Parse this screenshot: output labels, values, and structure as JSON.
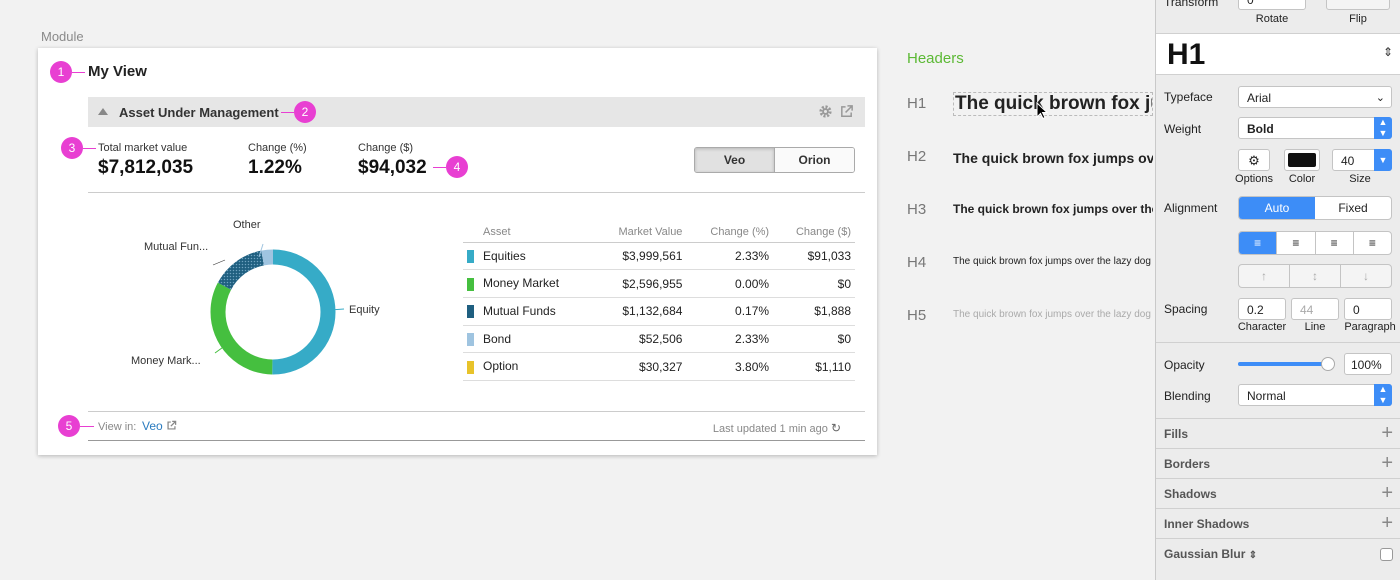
{
  "module_label": "Module",
  "card": {
    "title": "My View",
    "aum_title": "Asset Under Management",
    "stats": [
      {
        "label": "Total market value",
        "value": "$7,812,035"
      },
      {
        "label": "Change (%)",
        "value": "1.22%"
      },
      {
        "label": "Change ($)",
        "value": "$94,032"
      }
    ],
    "toggle": [
      "Veo",
      "Orion"
    ],
    "donut_labels": {
      "other": "Other",
      "mutual": "Mutual Fun...",
      "equity": "Equity",
      "money": "Money Mark..."
    },
    "table": {
      "headers": [
        "Asset",
        "Market  Value",
        "Change (%)",
        "Change ($)"
      ],
      "rows": [
        {
          "asset": "Equities",
          "value": "$3,999,561",
          "pct": "2.33%",
          "chg": "$91,033",
          "color": "#36abc7"
        },
        {
          "asset": "Money Market",
          "value": "$2,596,955",
          "pct": "0.00%",
          "chg": "$0",
          "color": "#45bf3f"
        },
        {
          "asset": "Mutual Funds",
          "value": "$1,132,684",
          "pct": "0.17%",
          "chg": "$1,888",
          "color": "#1f5f80"
        },
        {
          "asset": "Bond",
          "value": "$52,506",
          "pct": "2.33%",
          "chg": "$0",
          "color": "#9fc4e0"
        },
        {
          "asset": "Option",
          "value": "$30,327",
          "pct": "3.80%",
          "chg": "$1,110",
          "color": "#e8c32a"
        }
      ]
    },
    "footer": {
      "view_in": "View in:",
      "link": "Veo",
      "updated": "Last updated 1 min ago"
    },
    "badges": [
      "1",
      "2",
      "3",
      "4",
      "5"
    ]
  },
  "headers_panel": {
    "title": "Headers",
    "items": [
      {
        "tag": "H1",
        "text": "The quick brown fox jumps over the lazy dog"
      },
      {
        "tag": "H2",
        "text": "The quick brown fox jumps over the lazy dog"
      },
      {
        "tag": "H3",
        "text": "The quick brown fox jumps over the lazy dog"
      },
      {
        "tag": "H4",
        "text": "The quick brown fox jumps over the lazy dog"
      },
      {
        "tag": "H5",
        "text": "The quick brown fox jumps over the lazy dog"
      }
    ]
  },
  "inspector": {
    "transform_label": "Transform",
    "rotate_value": "0°",
    "rotate_label": "Rotate",
    "flip_label": "Flip",
    "style_name": "H1",
    "typeface_label": "Typeface",
    "typeface_value": "Arial",
    "weight_label": "Weight",
    "weight_value": "Bold",
    "options_label": "Options",
    "color_label": "Color",
    "size_label": "Size",
    "size_value": "40",
    "alignment_label": "Alignment",
    "align_auto": "Auto",
    "align_fixed": "Fixed",
    "spacing_label": "Spacing",
    "character_value": "0.2",
    "line_value": "44",
    "paragraph_value": "0",
    "character_label": "Character",
    "line_label": "Line",
    "paragraph_label": "Paragraph",
    "opacity_label": "Opacity",
    "opacity_value": "100%",
    "opacity_level": 1.0,
    "blending_label": "Blending",
    "blending_value": "Normal",
    "sections": [
      "Fills",
      "Borders",
      "Shadows",
      "Inner Shadows",
      "Gaussian Blur"
    ],
    "text_color": "#111111",
    "accent": "#3d8df7"
  }
}
